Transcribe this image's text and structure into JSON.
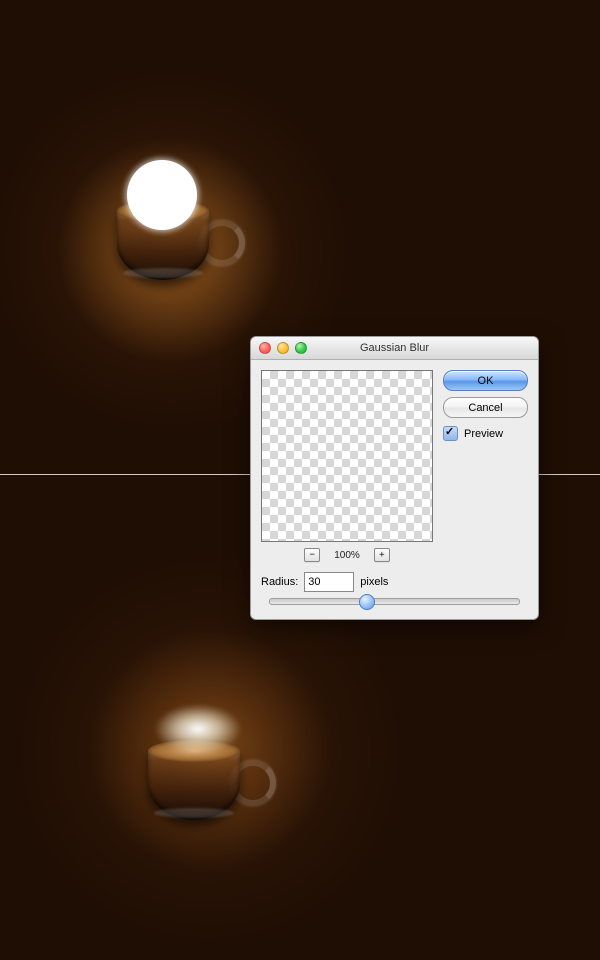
{
  "dialog": {
    "title": "Gaussian Blur",
    "ok_label": "OK",
    "cancel_label": "Cancel",
    "preview_label": "Preview",
    "preview_checked": true,
    "zoom_text": "100%",
    "zoom_out_glyph": "−",
    "zoom_in_glyph": "+",
    "radius_label": "Radius:",
    "radius_value": "30",
    "radius_unit": "pixels",
    "slider_percent": 39
  }
}
